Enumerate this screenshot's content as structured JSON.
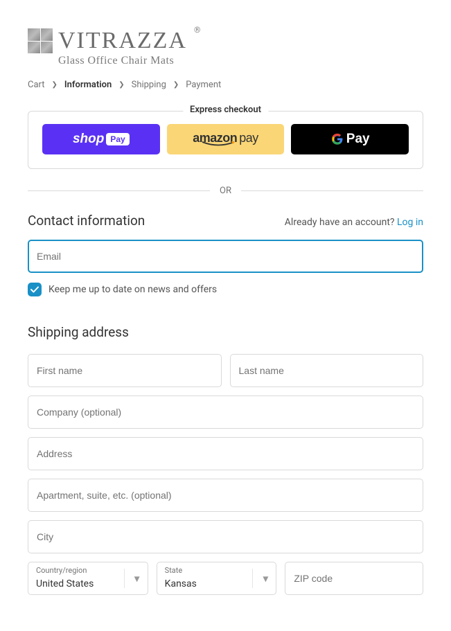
{
  "logo": {
    "brand": "VITRAZZA",
    "tagline": "Glass Office Chair Mats"
  },
  "breadcrumb": {
    "cart": "Cart",
    "information": "Information",
    "shipping": "Shipping",
    "payment": "Payment"
  },
  "express": {
    "label": "Express checkout",
    "shoppay_text": "shop",
    "shoppay_pill": "Pay",
    "amazon_text": "amazon",
    "amazon_pay": "pay",
    "gpay_text": "Pay"
  },
  "divider": {
    "or": "OR"
  },
  "contact": {
    "title": "Contact information",
    "login_prompt": "Already have an account?",
    "login_link": "Log in",
    "email_placeholder": "Email",
    "newsletter_label": "Keep me up to date on news and offers"
  },
  "shipping": {
    "title": "Shipping address",
    "first_name_placeholder": "First name",
    "last_name_placeholder": "Last name",
    "company_placeholder": "Company (optional)",
    "address_placeholder": "Address",
    "apartment_placeholder": "Apartment, suite, etc. (optional)",
    "city_placeholder": "City",
    "country_label": "Country/region",
    "country_value": "United States",
    "state_label": "State",
    "state_value": "Kansas",
    "zip_placeholder": "ZIP code"
  }
}
